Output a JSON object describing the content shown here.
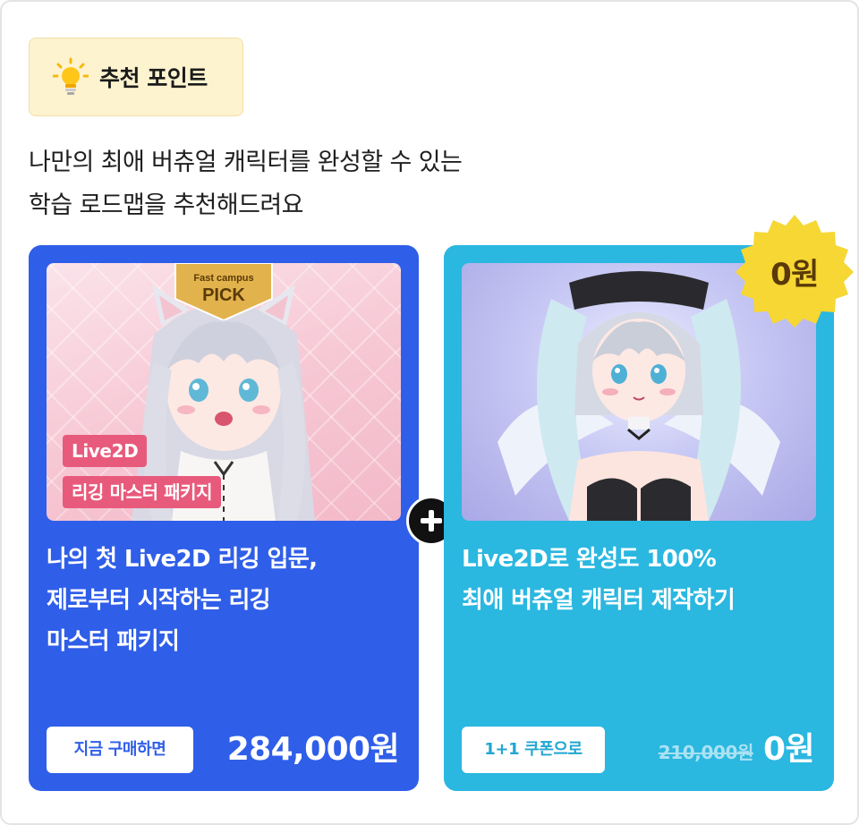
{
  "badge": {
    "label": "추천 포인트",
    "icon": "lightbulb-icon"
  },
  "description": {
    "line1": "나만의 최애 버츄얼 캐릭터를 완성할 수 있는",
    "line2": "학습 로드맵을 추천해드려요"
  },
  "card_left": {
    "pick": {
      "top": "Fast campus",
      "label": "PICK"
    },
    "tags": [
      "Live2D",
      "리깅 마스터 패키지"
    ],
    "title_lines": [
      "나의 첫 Live2D 리깅 입문,",
      "제로부터 시작하는 리깅",
      "마스터 패키지"
    ],
    "cta_label": "지금 구매하면",
    "price": "284,000원",
    "color": "#2f5ee8"
  },
  "card_right": {
    "title_lines": [
      "Live2D로 완성도 100%",
      "최애 버츄얼 캐릭터 제작하기"
    ],
    "cta_label": "1+1 쿠폰으로",
    "old_price": "210,000원",
    "price": "0원",
    "color": "#2ab7e0"
  },
  "free_badge": {
    "label": "0원",
    "color": "#f7d733"
  },
  "plus_icon": "plus-icon"
}
